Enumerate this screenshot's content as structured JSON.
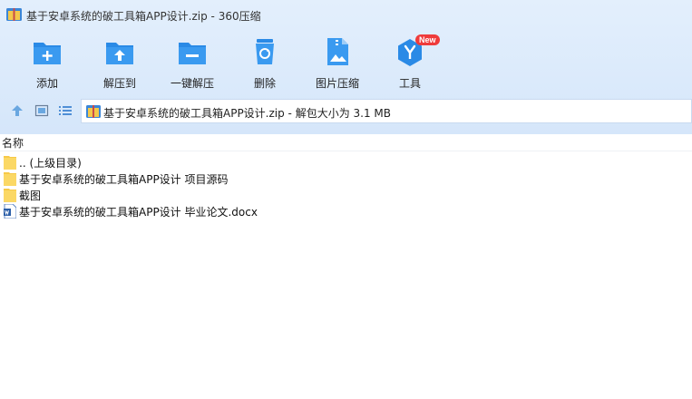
{
  "window": {
    "title": "基于安卓系统的破工具箱APP设计.zip - 360压缩"
  },
  "toolbar": {
    "items": [
      {
        "label": "添加",
        "icon": "add-icon"
      },
      {
        "label": "解压到",
        "icon": "extract-to-icon"
      },
      {
        "label": "一键解压",
        "icon": "one-click-extract-icon"
      },
      {
        "label": "删除",
        "icon": "delete-icon"
      },
      {
        "label": "图片压缩",
        "icon": "image-compress-icon"
      },
      {
        "label": "工具",
        "icon": "tools-icon",
        "badge": "New"
      }
    ]
  },
  "nav": {
    "address": "基于安卓系统的破工具箱APP设计.zip - 解包大小为 3.1 MB"
  },
  "list": {
    "column_name": "名称",
    "items": [
      {
        "name": ".. (上级目录)",
        "type": "folder"
      },
      {
        "name": "基于安卓系统的破工具箱APP设计 项目源码",
        "type": "folder"
      },
      {
        "name": "截图",
        "type": "folder"
      },
      {
        "name": "基于安卓系统的破工具箱APP设计 毕业论文.docx",
        "type": "docx"
      }
    ]
  },
  "colors": {
    "accent": "#2a8ae6",
    "chrome_bg": "#dbeafb",
    "badge": "#ef3b3b",
    "folder": "#f7c948"
  }
}
